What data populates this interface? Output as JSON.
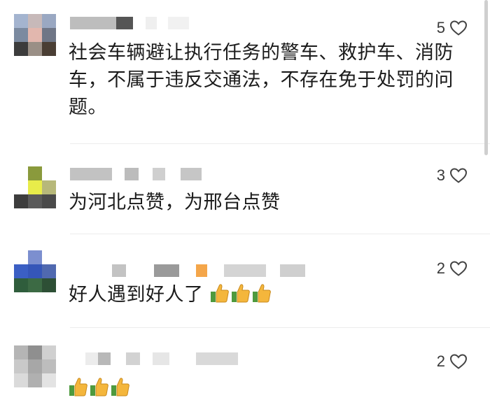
{
  "comments": [
    {
      "likes": "5",
      "text": "社会车辆避让执行任务的警车、救护车、消防车，不属于违反交通法，不存在免于处罚的问题。"
    },
    {
      "likes": "3",
      "text": "为河北点赞，为邢台点赞"
    },
    {
      "likes": "2",
      "text": "好人遇到好人了"
    },
    {
      "likes": "2",
      "text": ""
    }
  ],
  "colors": {
    "text": "#1b1b1b",
    "thumb_yellow": "#f4b63c",
    "thumb_green": "#4e9a3e",
    "heart_outline": "#444444"
  },
  "icons": [
    "heart-outline-icon",
    "thumbs-up-emoji-icon"
  ]
}
